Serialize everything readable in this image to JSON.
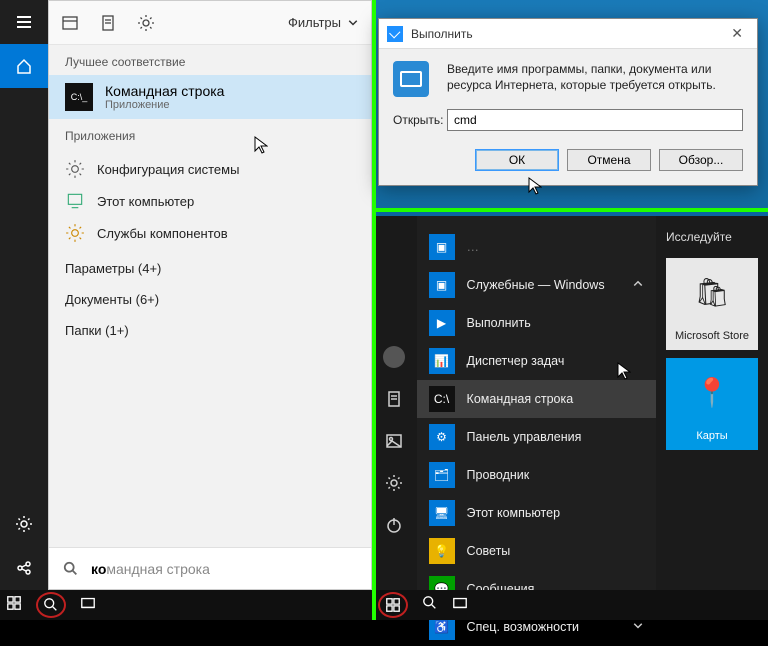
{
  "left": {
    "filters_label": "Фильтры",
    "best_match_label": "Лучшее соответствие",
    "best": {
      "title": "Командная строка",
      "subtitle": "Приложение"
    },
    "apps_label": "Приложения",
    "apps": [
      {
        "label": "Конфигурация системы"
      },
      {
        "label": "Этот компьютер"
      },
      {
        "label": "Службы компонентов"
      }
    ],
    "categories": [
      {
        "label": "Параметры (4+)"
      },
      {
        "label": "Документы (6+)"
      },
      {
        "label": "Папки (1+)"
      }
    ],
    "search_prefix": "ко",
    "search_rest": "мандная строка"
  },
  "run": {
    "title": "Выполнить",
    "description": "Введите имя программы, папки, документа или ресурса Интернета, которые требуется открыть.",
    "open_label": "Открыть:",
    "value": "cmd",
    "ok": "ОК",
    "cancel": "Отмена",
    "browse": "Обзор..."
  },
  "start": {
    "folder": "Служебные — Windows",
    "explore_label": "Исследуйте",
    "items": [
      {
        "label": "Выполнить",
        "icon": "run"
      },
      {
        "label": "Диспетчер задач",
        "icon": "task"
      },
      {
        "label": "Командная строка",
        "icon": "cmd",
        "hover": true
      },
      {
        "label": "Панель управления",
        "icon": "cpanel"
      },
      {
        "label": "Проводник",
        "icon": "explorer"
      },
      {
        "label": "Этот компьютер",
        "icon": "pc"
      }
    ],
    "extra": [
      {
        "label": "Советы",
        "icon": "tips"
      },
      {
        "label": "Сообщения",
        "icon": "msg"
      },
      {
        "label": "Спец. возможности",
        "icon": "access",
        "chev": true
      }
    ],
    "tiles": [
      {
        "label": "Microsoft Store",
        "kind": "store"
      },
      {
        "label": "Карты",
        "kind": "maps"
      }
    ]
  }
}
